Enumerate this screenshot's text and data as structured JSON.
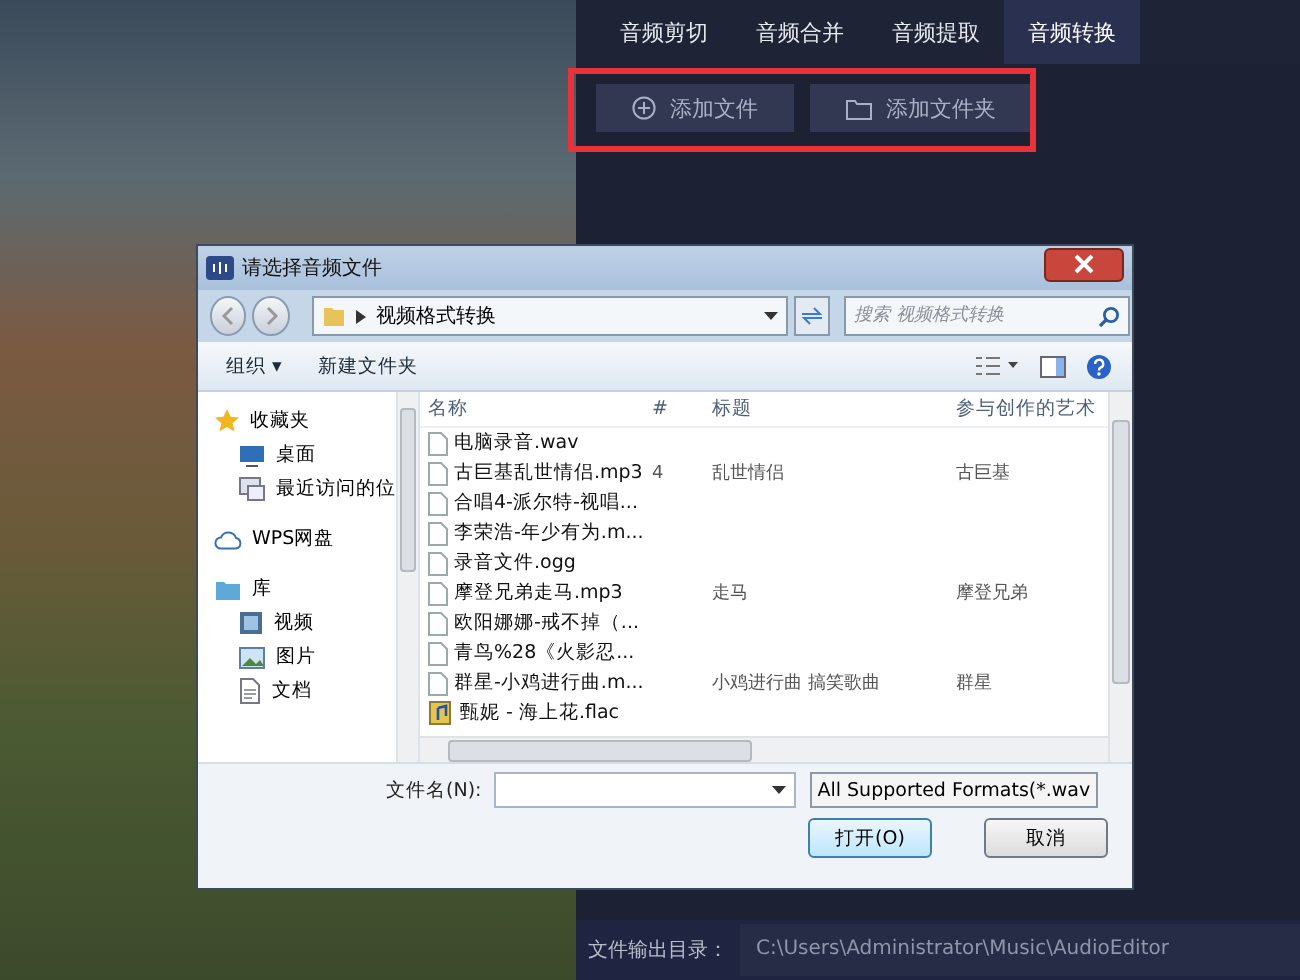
{
  "app": {
    "tabs": [
      {
        "label": "音频剪切",
        "selected": false
      },
      {
        "label": "音频合并",
        "selected": false
      },
      {
        "label": "音频提取",
        "selected": false
      },
      {
        "label": "音频转换",
        "selected": true
      }
    ],
    "buttons": [
      {
        "label": "添加文件",
        "kind": "add"
      },
      {
        "label": "添加文件夹",
        "kind": "folder"
      }
    ],
    "output_label": "文件输出目录：",
    "output_path": "C:\\Users\\Administrator\\Music\\AudioEditor"
  },
  "dialog": {
    "title": "请选择音频文件",
    "breadcrumb": "视频格式转换",
    "search": {
      "placeholder": "搜索 视频格式转换"
    },
    "toolbar": [
      "组织 ▾",
      "新建文件夹"
    ],
    "sidebar": [
      {
        "label": "收藏夹",
        "kind": "star",
        "children": [
          {
            "label": "桌面",
            "kind": "desktop"
          },
          {
            "label": "最近访问的位",
            "kind": "recent"
          }
        ]
      },
      {
        "label": "WPS网盘",
        "kind": "cloud"
      },
      {
        "label": "库",
        "kind": "library",
        "children": [
          {
            "label": "视频",
            "kind": "video"
          },
          {
            "label": "图片",
            "kind": "picture"
          },
          {
            "label": "文档",
            "kind": "document"
          }
        ]
      }
    ],
    "columns": [
      "名称",
      "#",
      "标题",
      "参与创作的艺术"
    ],
    "rows": [
      {
        "name": "电脑录音.wav",
        "number": "",
        "title": "",
        "artist": "",
        "kind": "file"
      },
      {
        "name": "古巨基乱世情侣.mp3",
        "number": "4",
        "title": "乱世情侣",
        "artist": "古巨基",
        "kind": "file"
      },
      {
        "name": "合唱4-派尔特-视唱...",
        "number": "",
        "title": "",
        "artist": "",
        "kind": "file"
      },
      {
        "name": "李荣浩-年少有为.m...",
        "number": "",
        "title": "",
        "artist": "",
        "kind": "file"
      },
      {
        "name": "录音文件.ogg",
        "number": "",
        "title": "",
        "artist": "",
        "kind": "file"
      },
      {
        "name": "摩登兄弟走马.mp3",
        "number": "",
        "title": "走马",
        "artist": "摩登兄弟",
        "kind": "file"
      },
      {
        "name": "欧阳娜娜-戒不掉（...",
        "number": "",
        "title": "",
        "artist": "",
        "kind": "file"
      },
      {
        "name": "青鸟%28《火影忍...",
        "number": "",
        "title": "",
        "artist": "",
        "kind": "file"
      },
      {
        "name": "群星-小鸡进行曲.m...",
        "number": "",
        "title": "小鸡进行曲 搞笑歌曲",
        "artist": "群星",
        "kind": "file"
      },
      {
        "name": "甄妮 - 海上花.flac",
        "number": "",
        "title": "",
        "artist": "",
        "kind": "media"
      }
    ],
    "filename_label": "文件名(N):",
    "filter": "All Supported Formats(*.wav",
    "open_button": "打开(O)",
    "cancel_button": "取消"
  }
}
